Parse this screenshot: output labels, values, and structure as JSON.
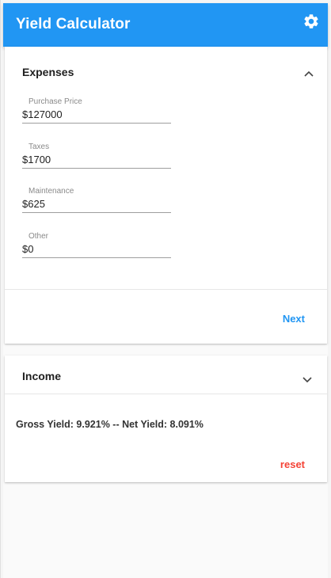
{
  "app": {
    "title": "Yield Calculator",
    "settings_icon": "gear-icon",
    "accent_color": "#2196f3"
  },
  "expenses": {
    "title": "Expenses",
    "toggle_icon": "chevron-up-icon",
    "fields": [
      {
        "label": "Purchase Price",
        "value": "$127000"
      },
      {
        "label": "Taxes",
        "value": "$1700"
      },
      {
        "label": "Maintenance",
        "value": "$625"
      },
      {
        "label": "Other",
        "value": "$0"
      }
    ],
    "next_label": "Next"
  },
  "income": {
    "title": "Income",
    "toggle_icon": "chevron-down-icon",
    "result_text": "Gross Yield: 9.921% -- Net Yield: 8.091%",
    "reset_label": "reset",
    "reset_color": "#f44336"
  }
}
